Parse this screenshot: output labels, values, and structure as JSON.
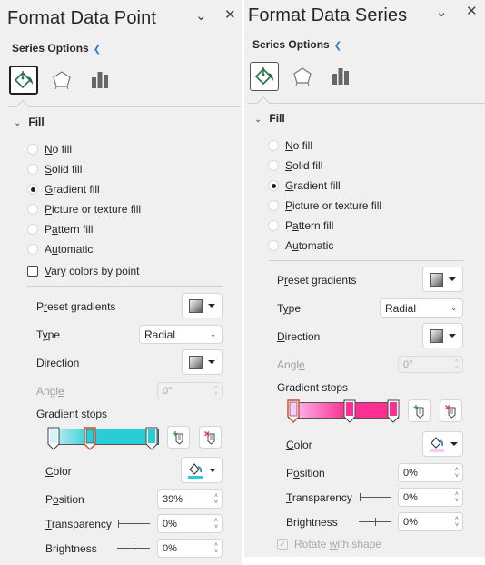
{
  "left_panel": {
    "title": "Format Data Point",
    "series_options_label": "Series Options",
    "tabs": [
      {
        "name": "fill-line",
        "icon": "paint-bucket-icon",
        "active": true
      },
      {
        "name": "effects",
        "icon": "pentagon-icon",
        "active": false
      },
      {
        "name": "series-options",
        "icon": "bar-chart-icon",
        "active": false
      }
    ],
    "fill_section_label": "Fill",
    "fill_options": [
      {
        "label": "No fill",
        "selected": false
      },
      {
        "label": "Solid fill",
        "selected": false
      },
      {
        "label": "Gradient fill",
        "selected": true
      },
      {
        "label": "Picture or texture fill",
        "selected": false
      },
      {
        "label": "Pattern fill",
        "selected": false
      },
      {
        "label": "Automatic",
        "selected": false
      }
    ],
    "vary_colors_label": "Vary colors by point",
    "vary_colors_checked": false,
    "preset_gradients_label": "Preset gradients",
    "type_label": "Type",
    "type_value": "Radial",
    "direction_label": "Direction",
    "angle_label": "Angle",
    "angle_value": "0°",
    "gradient_stops_label": "Gradient stops",
    "gradient_stops": [
      {
        "position_pct": 0,
        "color": "#d3f3f6",
        "selected": false
      },
      {
        "position_pct": 39,
        "color": "#29cdd5",
        "selected": true
      },
      {
        "position_pct": 100,
        "color": "#29cdd5",
        "selected": false
      }
    ],
    "color_label": "Color",
    "color_value": "#29cdd5",
    "position_label": "Position",
    "position_value": "39%",
    "transparency_label": "Transparency",
    "transparency_value": "0%",
    "transparency_slider_pct": 0,
    "brightness_label": "Brightness",
    "brightness_value": "0%",
    "brightness_slider_pct": 50
  },
  "right_panel": {
    "title": "Format Data Series",
    "series_options_label": "Series Options",
    "tabs": [
      {
        "name": "fill-line",
        "icon": "paint-bucket-icon",
        "active": true
      },
      {
        "name": "effects",
        "icon": "pentagon-icon",
        "active": false
      },
      {
        "name": "series-options",
        "icon": "bar-chart-icon",
        "active": false
      }
    ],
    "fill_section_label": "Fill",
    "fill_options": [
      {
        "label": "No fill",
        "selected": false
      },
      {
        "label": "Solid fill",
        "selected": false
      },
      {
        "label": "Gradient fill",
        "selected": true
      },
      {
        "label": "Picture or texture fill",
        "selected": false
      },
      {
        "label": "Pattern fill",
        "selected": false
      },
      {
        "label": "Automatic",
        "selected": false
      }
    ],
    "preset_gradients_label": "Preset gradients",
    "type_label": "Type",
    "type_value": "Radial",
    "direction_label": "Direction",
    "angle_label": "Angle",
    "angle_value": "0°",
    "gradient_stops_label": "Gradient stops",
    "gradient_stops": [
      {
        "position_pct": 0,
        "color": "#fdc8f3",
        "selected": true
      },
      {
        "position_pct": 52,
        "color": "#fd2f92",
        "selected": false
      },
      {
        "position_pct": 100,
        "color": "#fd2f92",
        "selected": false
      }
    ],
    "color_label": "Color",
    "color_value": "#fdc8f3",
    "position_label": "Position",
    "position_value": "0%",
    "transparency_label": "Transparency",
    "transparency_value": "0%",
    "transparency_slider_pct": 0,
    "brightness_label": "Brightness",
    "brightness_value": "0%",
    "brightness_slider_pct": 50,
    "rotate_with_shape_label": "Rotate with shape",
    "rotate_with_shape_checked": true,
    "rotate_with_shape_disabled": true
  }
}
